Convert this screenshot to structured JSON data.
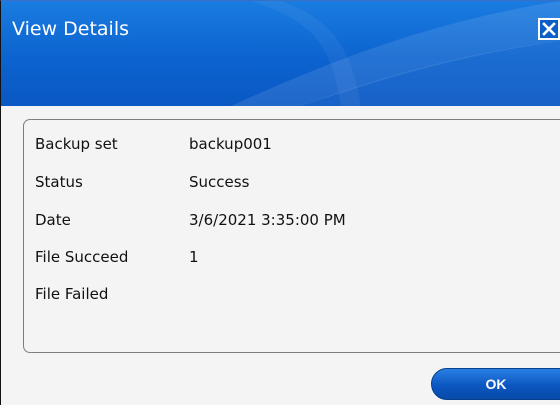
{
  "dialog": {
    "title": "View Details",
    "ok_label": "OK"
  },
  "details": [
    {
      "label": "Backup set",
      "value": "backup001"
    },
    {
      "label": "Status",
      "value": "Success"
    },
    {
      "label": "Date",
      "value": "3/6/2021 3:35:00 PM"
    },
    {
      "label": "File Succeed",
      "value": "1"
    },
    {
      "label": "File Failed",
      "value": ""
    }
  ],
  "colors": {
    "titlebar": "#0c63cf",
    "button": "#0b57c2",
    "panel_border": "#7d7d7d"
  },
  "icons": {
    "close": "close-icon"
  }
}
